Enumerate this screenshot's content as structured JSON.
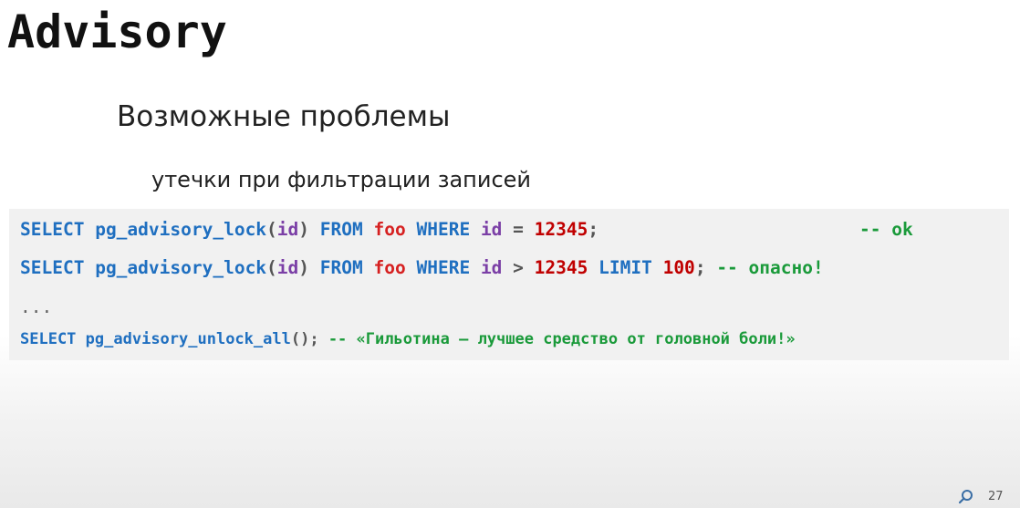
{
  "title": "Advisory",
  "heading": "Возможные проблемы",
  "bullet": "утечки при фильтрации записей",
  "code": {
    "line1": {
      "select": "SELECT",
      "fn": "pg_advisory_lock",
      "lparen": "(",
      "arg": "id",
      "rparen": ")",
      "from": "FROM",
      "table": "foo",
      "where": "WHERE",
      "col": "id",
      "op": "=",
      "num": "12345",
      "semi": ";",
      "comment": "-- ok"
    },
    "line2": {
      "select": "SELECT",
      "fn": "pg_advisory_lock",
      "lparen": "(",
      "arg": "id",
      "rparen": ")",
      "from": "FROM",
      "table": "foo",
      "where": "WHERE",
      "col": "id",
      "op": ">",
      "num": "12345",
      "limit": "LIMIT",
      "limit_num": "100",
      "semi": ";",
      "comment": "-- опасно!"
    },
    "line3": "...",
    "line4": {
      "select": "SELECT",
      "fn": "pg_advisory_unlock_all",
      "parens": "();",
      "comment": "-- «Гильотина – лучшее средство от головной боли!»"
    }
  },
  "page_number": "27",
  "colors": {
    "keyword": "#1f6fc0",
    "column": "#7b3fa6",
    "table": "#d62020",
    "number": "#c00000",
    "comment": "#1a9a3a",
    "code_background": "#f1f1f1"
  },
  "icons": {
    "corner": "search-icon"
  }
}
